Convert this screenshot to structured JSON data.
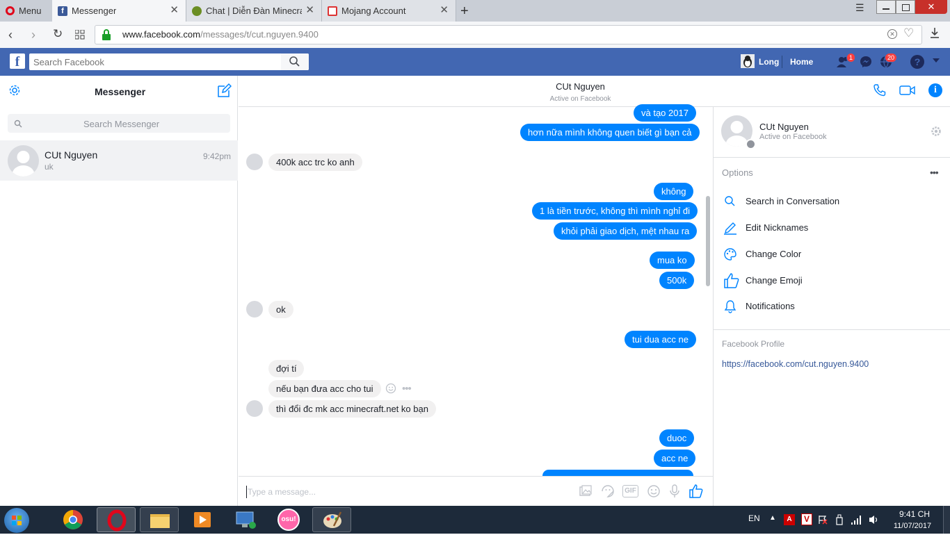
{
  "browser": {
    "menu_label": "Menu",
    "tabs": [
      {
        "label": "Messenger"
      },
      {
        "label": "Chat | Diễn Đàn Minecraft"
      },
      {
        "label": "Mojang Account"
      }
    ],
    "url_host": "www.facebook.com",
    "url_path": "/messages/t/cut.nguyen.9400"
  },
  "fb_header": {
    "search_placeholder": "Search Facebook",
    "user_name": "Long",
    "home_label": "Home",
    "friend_requests_count": "1",
    "notifications_count": "20"
  },
  "messenger": {
    "title": "Messenger",
    "search_placeholder": "Search Messenger",
    "conversations": [
      {
        "name": "CUt Nguyen",
        "preview": "uk",
        "time": "9:42pm"
      }
    ]
  },
  "conversation": {
    "name": "CUt Nguyen",
    "status": "Active on Facebook",
    "composer_placeholder": "Type a message...",
    "messages": [
      {
        "dir": "out",
        "text": "và tạo 2017"
      },
      {
        "dir": "out",
        "text": "hơn nữa mình không quen biết gì bạn cả"
      },
      {
        "dir": "in",
        "text": "400k acc trc ko anh"
      },
      {
        "dir": "out",
        "text": "không"
      },
      {
        "dir": "out",
        "text": "1 là tiền trước, không thì mình nghỉ đi"
      },
      {
        "dir": "out",
        "text": "khỏi phải giao dịch, mệt nhau ra"
      },
      {
        "dir": "out",
        "text": "mua ko"
      },
      {
        "dir": "out",
        "text": "500k"
      },
      {
        "dir": "in",
        "text": "ok"
      },
      {
        "dir": "out",
        "text": "tui dua acc ne"
      },
      {
        "dir": "in",
        "text": "đợi tí"
      },
      {
        "dir": "in",
        "text": "nếu bạn đưa acc cho tui"
      },
      {
        "dir": "in",
        "text": "thì đổi đc mk acc minecraft.net ko bạn"
      },
      {
        "dir": "out",
        "text": "duoc"
      },
      {
        "dir": "out",
        "text": "acc ne"
      }
    ]
  },
  "details": {
    "name": "CUt Nguyen",
    "status": "Active on Facebook",
    "options_label": "Options",
    "options": [
      {
        "label": "Search in Conversation",
        "icon": "search-icon"
      },
      {
        "label": "Edit Nicknames",
        "icon": "pencil-icon"
      },
      {
        "label": "Change Color",
        "icon": "palette-icon"
      },
      {
        "label": "Change Emoji",
        "icon": "thumbs-up-icon"
      },
      {
        "label": "Notifications",
        "icon": "bell-icon"
      }
    ],
    "profile_label": "Facebook Profile",
    "profile_url": "https://facebook.com/cut.nguyen.9400"
  },
  "taskbar": {
    "language": "EN",
    "time": "9:41 CH",
    "date": "11/07/2017",
    "osu_label": "osu!"
  },
  "colors": {
    "fb_blue": "#4267b2",
    "messenger_blue": "#0084ff",
    "incoming_bubble": "#f1f0f0"
  }
}
